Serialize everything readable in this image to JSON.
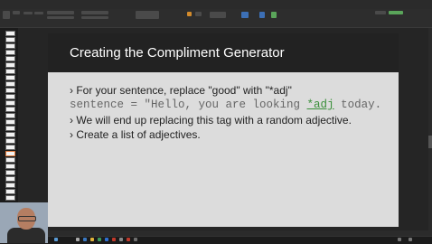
{
  "slide": {
    "title": "Creating the Compliment Generator",
    "bullet1": "› For your sentence, replace \"good\" with \"*adj\"",
    "code_prefix": "sentence = \"Hello, you are looking ",
    "code_keyword": "*adj",
    "code_suffix": " today.",
    "bullet2": "› We will end up replacing this tag with a random adjective.",
    "bullet3": "› Create a list of adjectives."
  },
  "colors": {
    "slide_background": "#dcdcdc",
    "header_background": "#222222",
    "code_keyword": "#3a8f3a"
  }
}
